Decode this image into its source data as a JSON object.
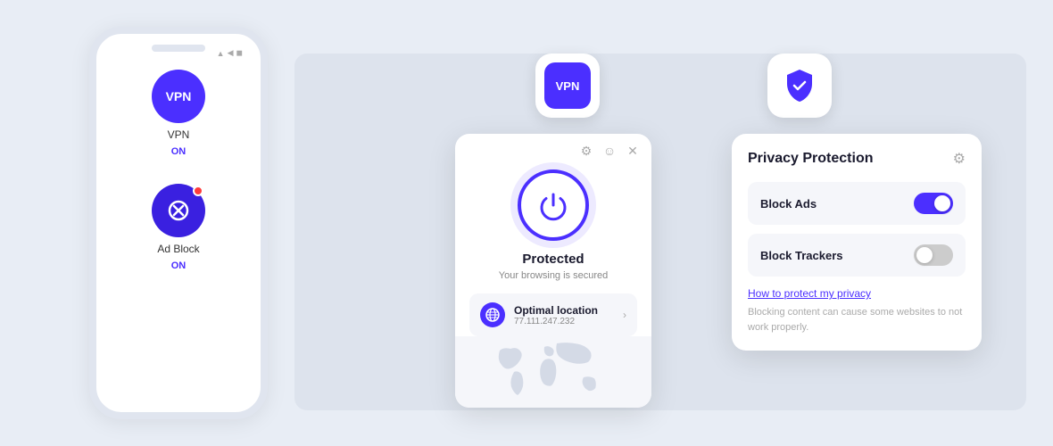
{
  "background": {
    "color": "#e8edf5"
  },
  "phone": {
    "status_text": "●●● ▲ ◀",
    "vpn_label": "VPN",
    "vpn_status": "ON",
    "adblock_label": "Ad Block",
    "adblock_status": "ON"
  },
  "vpn_badge": {
    "label": "VPN"
  },
  "vpn_popup": {
    "status_title": "Protected",
    "status_subtitle": "Your browsing is secured",
    "location_name": "Optimal location",
    "location_ip": "77.111.247.232"
  },
  "shield_badge": {
    "icon": "shield-check"
  },
  "privacy_panel": {
    "title": "Privacy Protection",
    "block_ads_label": "Block Ads",
    "block_ads_on": true,
    "block_trackers_label": "Block Trackers",
    "block_trackers_on": false,
    "link_text": "How to protect my privacy",
    "note_text": "Blocking content can cause some websites to not work properly."
  }
}
